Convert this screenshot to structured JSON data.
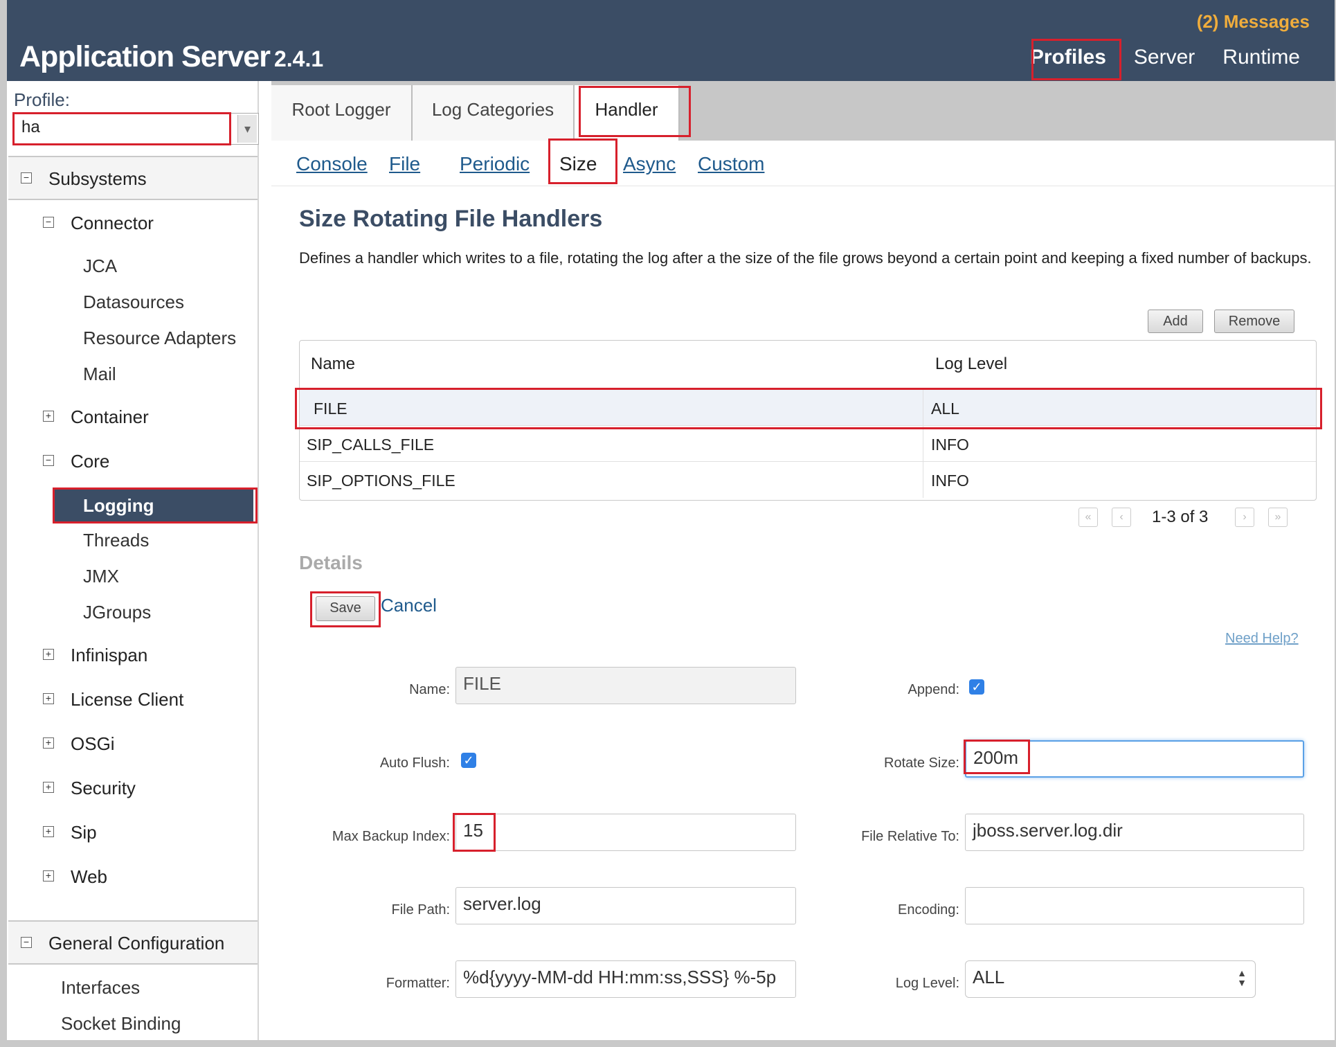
{
  "header": {
    "brand": "Application Server",
    "version": "2.4.1",
    "messages": "(2) Messages",
    "nav": [
      "Profiles",
      "Server",
      "Runtime"
    ]
  },
  "sidebar": {
    "profile_label": "Profile:",
    "profile_value": "ha",
    "subsystems": "Subsystems",
    "connector": "Connector",
    "connector_items": [
      "JCA",
      "Datasources",
      "Resource Adapters",
      "Mail"
    ],
    "container": "Container",
    "core": "Core",
    "core_items": [
      "Logging",
      "Threads",
      "JMX",
      "JGroups"
    ],
    "more": [
      "Infinispan",
      "License Client",
      "OSGi",
      "Security",
      "Sip",
      "Web"
    ],
    "general": "General Configuration",
    "general_items": [
      "Interfaces",
      "Socket Binding"
    ]
  },
  "tabs": [
    "Root Logger",
    "Log Categories",
    "Handler"
  ],
  "subnav": [
    "Console",
    "File",
    "Periodic",
    "Size",
    "Async",
    "Custom"
  ],
  "page": {
    "title": "Size Rotating File Handlers",
    "description": "Defines a handler which writes to a file, rotating the log after a the size of the file grows beyond a certain point and keeping a fixed number of backups.",
    "add": "Add",
    "remove": "Remove"
  },
  "table": {
    "headers": [
      "Name",
      "Log Level"
    ],
    "rows": [
      {
        "name": "FILE",
        "level": "ALL"
      },
      {
        "name": "SIP_CALLS_FILE",
        "level": "INFO"
      },
      {
        "name": "SIP_OPTIONS_FILE",
        "level": "INFO"
      }
    ],
    "pager": "1-3 of 3"
  },
  "details": {
    "title": "Details",
    "save": "Save",
    "cancel": "Cancel",
    "help": "Need Help?",
    "labels": {
      "name": "Name:",
      "append": "Append:",
      "auto_flush": "Auto Flush:",
      "rotate_size": "Rotate Size:",
      "max_backup": "Max Backup Index:",
      "file_relative": "File Relative To:",
      "file_path": "File Path:",
      "encoding": "Encoding:",
      "formatter": "Formatter:",
      "log_level": "Log Level:"
    },
    "values": {
      "name": "FILE",
      "rotate_size": "200m",
      "max_backup": "15",
      "file_relative": "jboss.server.log.dir",
      "file_path": "server.log",
      "encoding": "",
      "formatter": "%d{yyyy-MM-dd HH:mm:ss,SSS} %-5p",
      "log_level": "ALL"
    },
    "append_checked": true,
    "auto_flush_checked": true
  }
}
